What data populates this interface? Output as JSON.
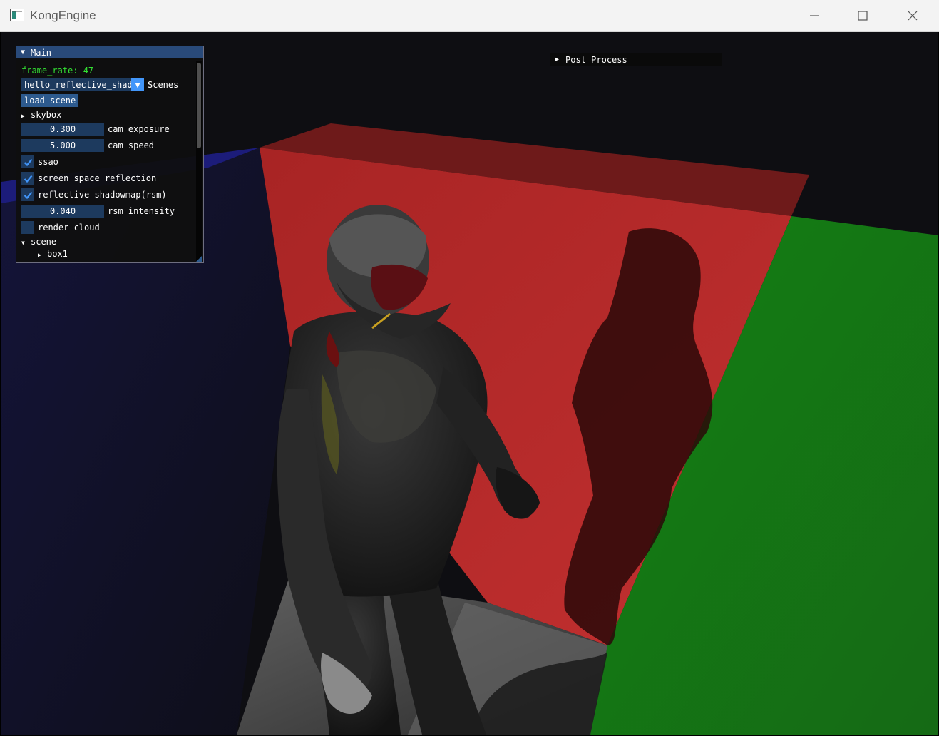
{
  "window": {
    "title": "KongEngine"
  },
  "colors": {
    "wall_red": "#b52626",
    "wall_green": "#1a7a1a",
    "wall_blue": "#1a1a8a",
    "floor": "#4a4a4a",
    "imgui_title": "#294a7a",
    "imgui_frame": "#1d3a5e",
    "check_mark": "#4296fa",
    "fps_text": "#33e033"
  },
  "main_panel": {
    "title": "Main",
    "frame_rate": "frame_rate: 47",
    "scene_select": {
      "value": "hello_reflective_shadowmap",
      "label": "Scenes"
    },
    "load_scene_label": "load scene",
    "skybox_label": "skybox",
    "cam_exposure": {
      "value": "0.300",
      "label": "cam exposure"
    },
    "cam_speed": {
      "value": "5.000",
      "label": "cam speed"
    },
    "ssao": {
      "label": "ssao",
      "checked": true
    },
    "ssr": {
      "label": "screen space reflection",
      "checked": true
    },
    "rsm": {
      "label": "reflective shadowmap(rsm)",
      "checked": true
    },
    "rsm_intensity": {
      "value": "0.040",
      "label": "rsm intensity"
    },
    "render_cloud": {
      "label": "render cloud",
      "checked": false
    },
    "scene_tree_label": "scene",
    "box1_label": "box1"
  },
  "post_process": {
    "title": "Post Process"
  }
}
